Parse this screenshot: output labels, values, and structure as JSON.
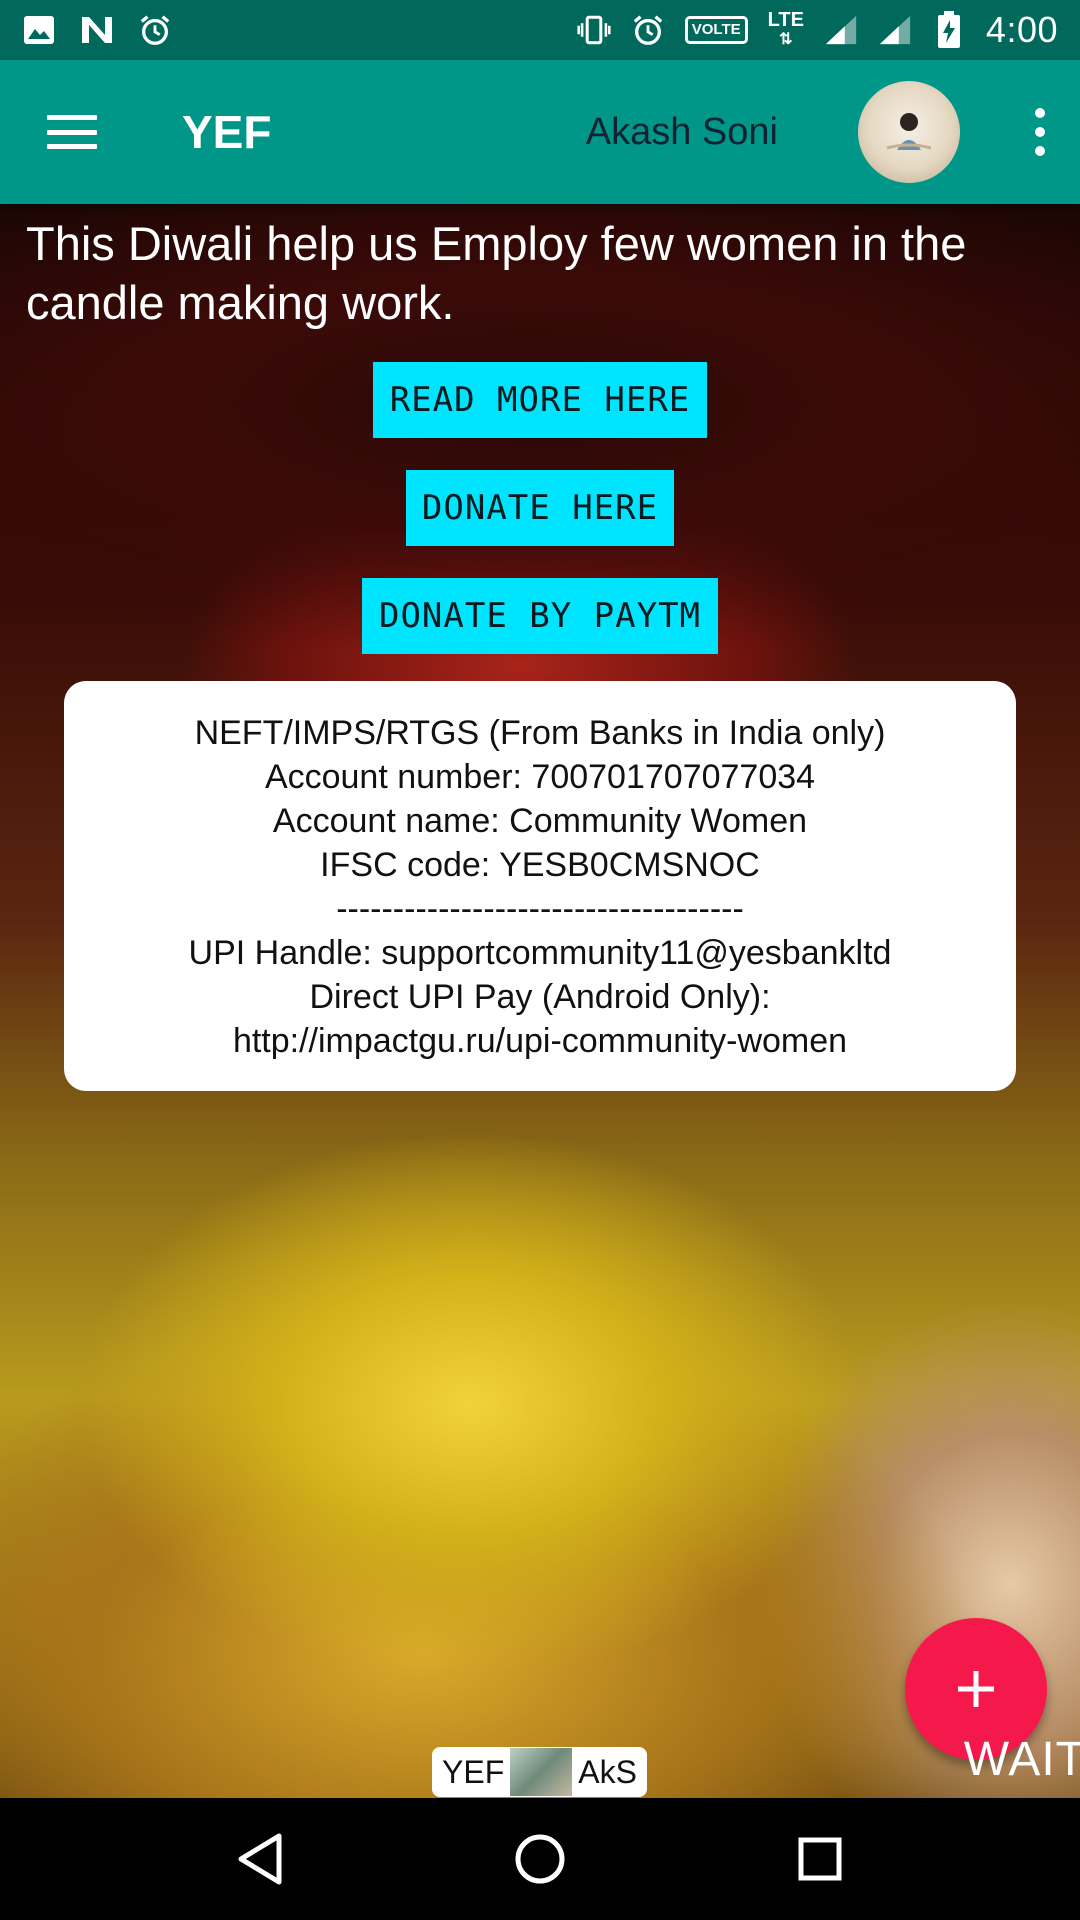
{
  "status_bar": {
    "time": "4:00",
    "volte": "VOLTE",
    "lte": "LTE",
    "icons": [
      "image-icon",
      "n-icon",
      "alarm-icon",
      "vibrate-icon",
      "alarm-icon",
      "signal-icon",
      "signal-icon",
      "battery-charging-icon"
    ]
  },
  "app_bar": {
    "title": "YEF",
    "user_name": "Akash Soni",
    "colors": {
      "status": "#00695c",
      "toolbar": "#009688"
    }
  },
  "content": {
    "headline": "This Diwali help us Employ few women in the candle making work.",
    "buttons": {
      "read_more": "READ MORE HERE",
      "donate": "DONATE HERE",
      "donate_paytm": "DONATE BY PAYTM"
    },
    "button_color": "#00e5ff",
    "bank_info": {
      "line1": "NEFT/IMPS/RTGS (From Banks in India only)",
      "line2": "Account number: 700701707077034",
      "line3": "Account name: Community Women",
      "line4": "IFSC code: YESB0CMSNOC",
      "divider": "------------------------------------",
      "line5": "UPI Handle: supportcommunity11@yesbankltd",
      "line6": "Direct UPI Pay (Android Only):",
      "line7": "http://impactgu.ru/upi-community-women"
    },
    "wait_text": "WAIT",
    "badge": {
      "left": "YEF",
      "right": "AkS"
    },
    "fab_color": "#f5184b"
  },
  "nav_bar": {
    "back": "back-icon",
    "home": "home-icon",
    "recents": "recents-icon"
  }
}
